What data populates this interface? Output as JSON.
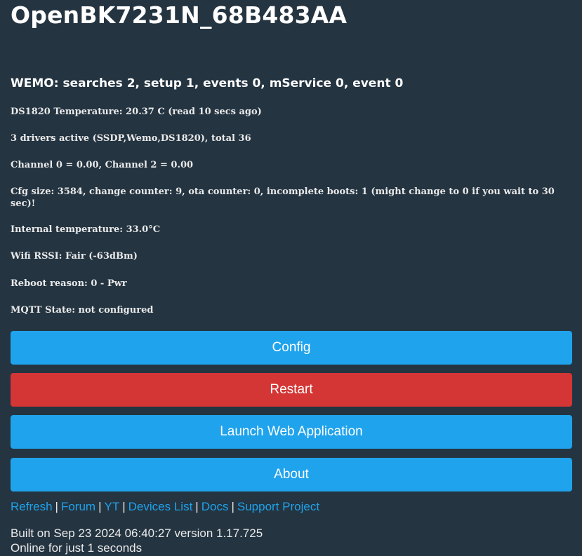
{
  "header": {
    "title": "OpenBK7231N_68B483AA"
  },
  "status": {
    "wemo": "WEMO: searches 2, setup 1, events 0, mService 0, event 0",
    "ds1820": "DS1820 Temperature: 20.37 C (read 10 secs ago)",
    "drivers": "3 drivers active (SSDP,Wemo,DS1820), total 36",
    "channels": "Channel 0 = 0.00, Channel 2 = 0.00",
    "cfg": "Cfg size: 3584, change counter: 9, ota counter: 0, incomplete boots: 1 (might change to 0 if you wait to 30 sec)!",
    "internal_temp": "Internal temperature: 33.0°C",
    "wifi": "Wifi RSSI: Fair (-63dBm)",
    "reboot": "Reboot reason: 0 - Pwr",
    "mqtt": "MQTT State: not configured"
  },
  "buttons": {
    "config": "Config",
    "restart": "Restart",
    "launch": "Launch Web Application",
    "about": "About"
  },
  "links": {
    "items": [
      "Refresh",
      "Forum",
      "YT",
      "Devices List",
      "Docs",
      "Support Project"
    ],
    "separator": "|"
  },
  "footer": {
    "built": "Built on Sep 23 2024 06:40:27 version 1.17.725",
    "online": "Online for just 1 seconds"
  },
  "colors": {
    "background": "#243441",
    "primary_button": "#1fa3ec",
    "danger_button": "#d43535",
    "link": "#1fa3ec"
  }
}
